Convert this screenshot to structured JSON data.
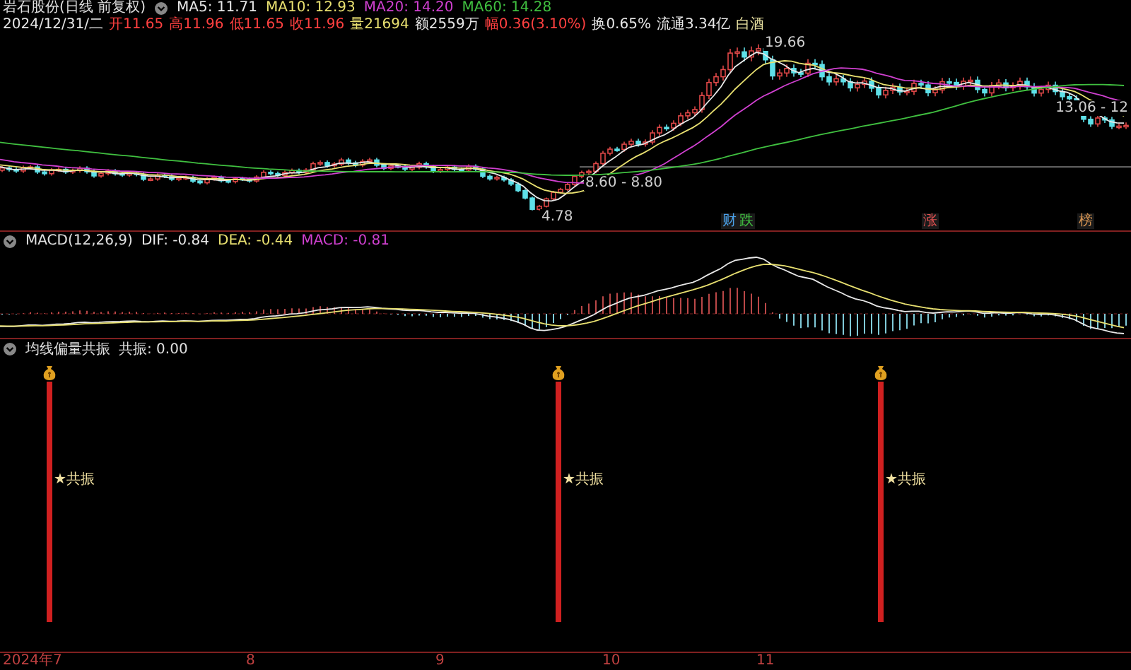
{
  "title": "岩石股份(日线 前复权)",
  "ma_legend": [
    {
      "label": "MA5: 11.71",
      "color": "#e8e8e8"
    },
    {
      "label": "MA10: 12.93",
      "color": "#e8e070"
    },
    {
      "label": "MA20: 14.20",
      "color": "#d040d0"
    },
    {
      "label": "MA60: 14.28",
      "color": "#40c040"
    }
  ],
  "quote": [
    {
      "text": "2024/12/31/二",
      "color": "#e8e8e8"
    },
    {
      "text": "开11.65",
      "color": "#ff4040"
    },
    {
      "text": "高11.96",
      "color": "#ff4040"
    },
    {
      "text": "低11.65",
      "color": "#ff4040"
    },
    {
      "text": "收11.96",
      "color": "#ff4040"
    },
    {
      "text": "量21694",
      "color": "#e8e070"
    },
    {
      "text": "额2559万",
      "color": "#e8e8e8"
    },
    {
      "text": "幅0.36(3.10%)",
      "color": "#ff4040"
    },
    {
      "text": "换0.65%",
      "color": "#e8e8e8"
    },
    {
      "text": "流通3.34亿",
      "color": "#e8e8e8"
    },
    {
      "text": "白酒",
      "color": "#e8e0a0"
    }
  ],
  "price_labels": [
    {
      "text": "19.66"
    },
    {
      "text": "8.60 - 8.80"
    },
    {
      "text": "4.78"
    },
    {
      "text": "13.06 - 12"
    }
  ],
  "event_markers": [
    {
      "text": "财",
      "color": "#4aa0e8"
    },
    {
      "text": "跌",
      "color": "#40c040"
    },
    {
      "text": "涨",
      "color": "#e05050"
    },
    {
      "text": "榜",
      "color": "#d09050"
    }
  ],
  "macd": {
    "name": "MACD(12,26,9)",
    "values": [
      {
        "label": "DIF: -0.84",
        "color": "#e8e8e8"
      },
      {
        "label": "DEA: -0.44",
        "color": "#e8e070"
      },
      {
        "label": "MACD: -0.81",
        "color": "#d040d0"
      }
    ]
  },
  "indicator": {
    "name": "均线偏量共振",
    "value": "共振: 0.00",
    "signals": [
      {
        "label": "★共振"
      },
      {
        "label": "★共振"
      },
      {
        "label": "★共振"
      }
    ]
  },
  "x_axis": [
    "2024年7",
    "8",
    "9",
    "10",
    "11"
  ]
}
